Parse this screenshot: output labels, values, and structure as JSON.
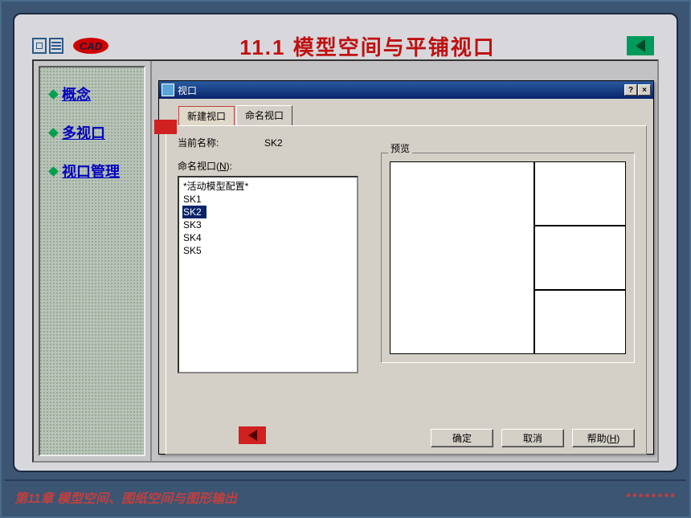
{
  "header": {
    "logo": "CAD",
    "title": "11.1 模型空间与平铺视口"
  },
  "sidebar": {
    "items": [
      {
        "label": "概念"
      },
      {
        "label": "多视口"
      },
      {
        "label": "视口管理"
      }
    ]
  },
  "dialog": {
    "title": "视口",
    "help_btn": "?",
    "close_btn": "×",
    "tabs": [
      {
        "label": "新建视口",
        "active": false
      },
      {
        "label": "命名视口",
        "active": true
      }
    ],
    "current_name_label": "当前名称:",
    "current_name_value": "SK2",
    "list_label_pre": "命名视口(",
    "list_label_key": "N",
    "list_label_post": "):",
    "list_items": [
      {
        "label": "*活动模型配置*",
        "selected": false
      },
      {
        "label": "SK1",
        "selected": false
      },
      {
        "label": "SK2",
        "selected": true
      },
      {
        "label": "SK3",
        "selected": false
      },
      {
        "label": "SK4",
        "selected": false
      },
      {
        "label": "SK5",
        "selected": false
      }
    ],
    "preview_label": "预览",
    "buttons": {
      "ok": "确定",
      "cancel": "取消",
      "help_pre": "帮助(",
      "help_key": "H",
      "help_post": ")"
    }
  },
  "footer": {
    "text": "第11章 模型空间、图纸空间与图形输出",
    "stars": "********"
  }
}
